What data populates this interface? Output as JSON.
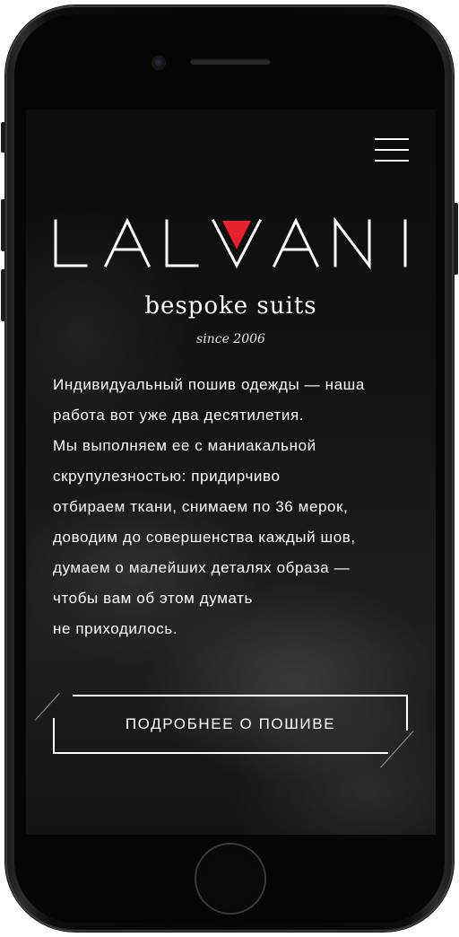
{
  "header": {
    "menu_icon": "hamburger-menu-icon"
  },
  "brand": {
    "logo_text": "LALVANI",
    "tagline": "bespoke suits",
    "since": "since 2006",
    "accent_color": "#e3222b"
  },
  "intro": {
    "lines": [
      "Индивидуальный пошив одежды — наша",
      "работа вот уже два десятилетия.",
      "Мы выполняем ее с маниакальной",
      "скрупулезностью: придирчиво",
      "отбираем ткани, снимаем по 36 мерок,",
      "доводим до совершенства каждый шов,",
      "думаем о малейших деталях образа —",
      "чтобы вам об этом думать",
      "не приходилось."
    ]
  },
  "cta": {
    "label": "ПОДРОБНЕЕ О ПОШИВЕ"
  },
  "device": {
    "home_button_icon": "home-button-icon",
    "camera_icon": "front-camera-icon",
    "speaker_icon": "earpiece-speaker-icon"
  }
}
